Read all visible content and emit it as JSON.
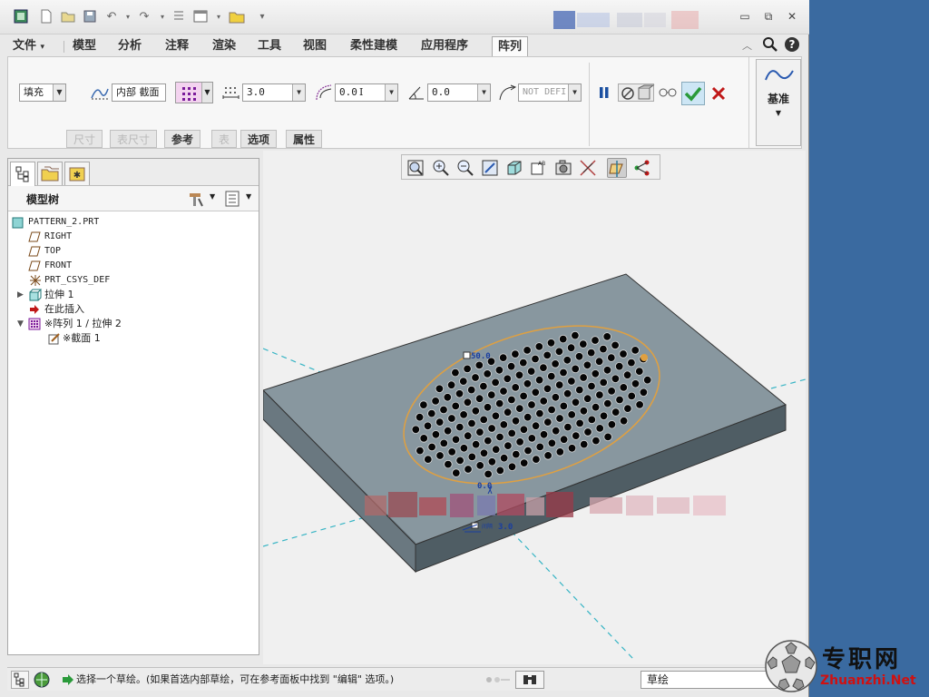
{
  "quick_access": {
    "icons": [
      "app-icon",
      "new-icon",
      "open-icon",
      "save-icon",
      "undo-icon",
      "redo-icon",
      "regen-icon",
      "windows-icon",
      "folder-icon",
      "more-icon"
    ]
  },
  "window": {
    "minimize": "▭",
    "restore": "⧉",
    "close": "✕"
  },
  "tabs": [
    {
      "label": "文件",
      "dropdown": "▾"
    },
    {
      "label": "模型"
    },
    {
      "label": "分析"
    },
    {
      "label": "注释"
    },
    {
      "label": "渲染"
    },
    {
      "label": "工具"
    },
    {
      "label": "视图"
    },
    {
      "label": "柔性建模"
    },
    {
      "label": "应用程序"
    },
    {
      "label": "阵列",
      "active": true
    }
  ],
  "ribbon": {
    "pattern_type": "填充",
    "sketch_label": "内部 截面",
    "spacing_value": "3.0",
    "rotation_value": "0.0",
    "border_value": "0.0",
    "radius_value": "NOT DEFI",
    "datum_label": "基准",
    "subtabs": [
      {
        "label": "尺寸",
        "enabled": false
      },
      {
        "label": "表尺寸",
        "enabled": false
      },
      {
        "label": "参考",
        "enabled": true
      },
      {
        "label": "表",
        "enabled": false
      },
      {
        "label": "选项",
        "enabled": true
      },
      {
        "label": "属性",
        "enabled": true
      }
    ]
  },
  "model_tree": {
    "title": "模型树",
    "items": [
      {
        "label": "PATTERN_2.PRT",
        "icon": "part-icon",
        "indent": 0
      },
      {
        "label": "RIGHT",
        "icon": "datum-plane-icon",
        "indent": 1
      },
      {
        "label": "TOP",
        "icon": "datum-plane-icon",
        "indent": 1
      },
      {
        "label": "FRONT",
        "icon": "datum-plane-icon",
        "indent": 1
      },
      {
        "label": "PRT_CSYS_DEF",
        "icon": "csys-icon",
        "indent": 1
      },
      {
        "label": "拉伸 1",
        "icon": "extrude-icon",
        "indent": 1
      },
      {
        "label": "在此插入",
        "icon": "insert-arrow-icon",
        "indent": 1
      },
      {
        "label": "※阵列 1 / 拉伸 2",
        "icon": "pattern-icon",
        "indent": 1
      },
      {
        "label": "※截面 1",
        "icon": "sketch-icon",
        "indent": 2
      }
    ]
  },
  "viewport": {
    "dim_top": "50.0",
    "dim_bottom": "0.0",
    "dim_spacing": "3.0",
    "dim_spacing_label": "间隔"
  },
  "status": {
    "message": "选择一个草绘。(如果首选内部草绘，可在参考面板中找到 \"编辑\" 选项。)",
    "filter": "草绘"
  },
  "watermark": {
    "cn": "专职网",
    "en": "Zhuanzhi.Net"
  },
  "colors": {
    "accent_blue": "#1a4fa0",
    "confirm_green": "#2a9a3a",
    "cancel_red": "#c01818",
    "plate": "#7e8e98",
    "sketch_orange": "#e0a040"
  }
}
